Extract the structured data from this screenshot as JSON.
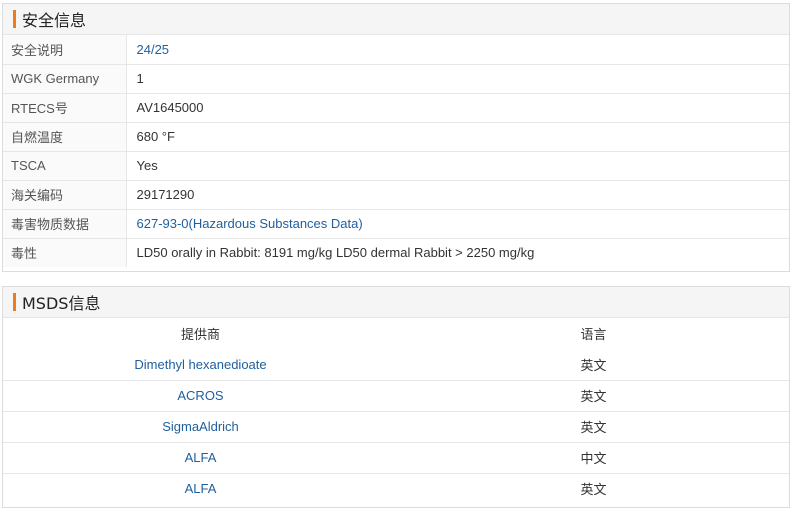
{
  "safety": {
    "title": "安全信息",
    "rows": [
      {
        "key": "安全说明",
        "value": "24/25"
      },
      {
        "key": "WGK Germany",
        "value": "1"
      },
      {
        "key": "RTECS号",
        "value": "AV1645000"
      },
      {
        "key": "自燃温度",
        "value": "680 °F"
      },
      {
        "key": "TSCA",
        "value": "Yes"
      },
      {
        "key": "海关编码",
        "value": "29171290"
      },
      {
        "key": "毒害物质数据",
        "value": "627-93-0(Hazardous Substances Data)"
      },
      {
        "key": "毒性",
        "value": "LD50 orally in Rabbit: 8191 mg/kg LD50 dermal Rabbit > 2250 mg/kg"
      }
    ]
  },
  "msds": {
    "title": "MSDS信息",
    "headers": {
      "supplier": "提供商",
      "language": "语言"
    },
    "rows": [
      {
        "supplier": "Dimethyl hexanedioate",
        "language": "英文"
      },
      {
        "supplier": "ACROS",
        "language": "英文"
      },
      {
        "supplier": "SigmaAldrich",
        "language": "英文"
      },
      {
        "supplier": "ALFA",
        "language": "中文"
      },
      {
        "supplier": "ALFA",
        "language": "英文"
      }
    ]
  },
  "colors": {
    "accent": "#f07b1c",
    "link": "#1f5f9e"
  }
}
